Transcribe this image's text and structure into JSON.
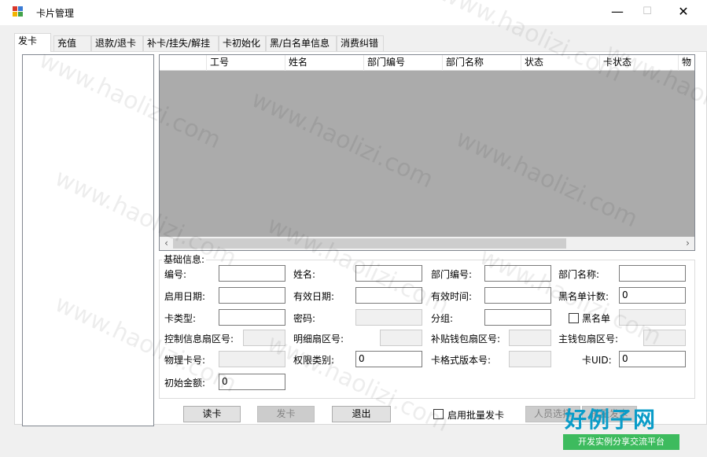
{
  "window": {
    "title": "卡片管理",
    "controls": {
      "minimize": "—",
      "maximize": "☐",
      "close": "✕"
    }
  },
  "tabs": [
    "发卡",
    "充值",
    "退款/退卡",
    "补卡/挂失/解挂",
    "卡初始化",
    "黑/白名单信息",
    "消费纠错"
  ],
  "grid": {
    "columns": [
      "",
      "工号",
      "姓名",
      "部门编号",
      "部门名称",
      "状态",
      "卡状态",
      "物"
    ]
  },
  "form": {
    "group_title": "基础信息:",
    "labels": {
      "id": "编号:",
      "name": "姓名:",
      "dept_no": "部门编号:",
      "dept_name": "部门名称:",
      "start_date": "启用日期:",
      "valid_date": "有效日期:",
      "valid_time": "有效时间:",
      "blacklist_count": "黑名单计数:",
      "card_type": "卡类型:",
      "password": "密码:",
      "group": "分组:",
      "blacklist": "黑名单",
      "ctrl_sector": "控制信息扇区号:",
      "detail_sector": "明细扇区号:",
      "subsidy_sector": "补贴钱包扇区号:",
      "main_sector": "主钱包扇区号:",
      "phys_card": "物理卡号:",
      "perm_type": "权限类别:",
      "card_format": "卡格式版本号:",
      "card_uid": "卡UID:",
      "init_amount": "初始金额:"
    },
    "values": {
      "blacklist_count": "0",
      "perm_type": "0",
      "card_uid": "0",
      "init_amount": "0"
    }
  },
  "buttons": {
    "read_card": "读卡",
    "issue_card": "发卡",
    "exit": "退出",
    "batch_enable": "启用批量发卡",
    "select_person": "人员选择",
    "batch_issue": "批量发卡"
  },
  "watermark": "www.haolizi.com",
  "logo": {
    "main": "好例子网",
    "sub": "开发实例分享交流平台"
  }
}
